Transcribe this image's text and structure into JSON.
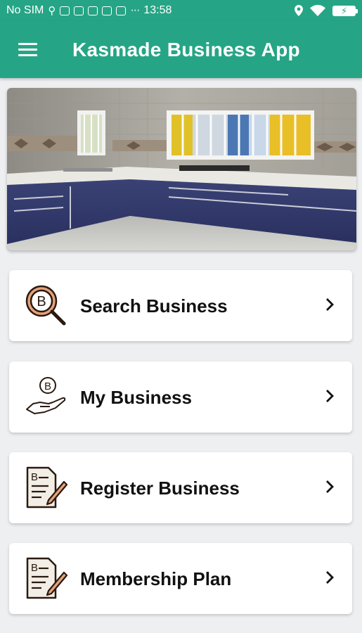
{
  "status_bar": {
    "carrier": "No SIM",
    "usb_symbol": "⚲",
    "dots": "···",
    "time": "13:58",
    "notification_icons": [
      "usb-icon",
      "message-icon",
      "mail-icon",
      "document-icon",
      "gmail-icon",
      "chat-icon"
    ],
    "right_icons": [
      "location-icon",
      "wifi-icon",
      "battery-charging-icon"
    ]
  },
  "app_bar": {
    "title": "Kasmade Business App",
    "menu_icon": "hamburger-menu-icon"
  },
  "banner": {
    "description_icon": "kitchen-photo"
  },
  "menu_cards": [
    {
      "label": "Search Business",
      "icon": "search-business-icon"
    },
    {
      "label": "My Business",
      "icon": "hand-coin-icon"
    },
    {
      "label": "Register Business",
      "icon": "document-pen-icon"
    },
    {
      "label": "Membership Plan",
      "icon": "document-pen-icon"
    }
  ],
  "colors": {
    "primary": "#26a586",
    "background": "#eeeff1",
    "card": "#ffffff",
    "text": "#111111"
  }
}
